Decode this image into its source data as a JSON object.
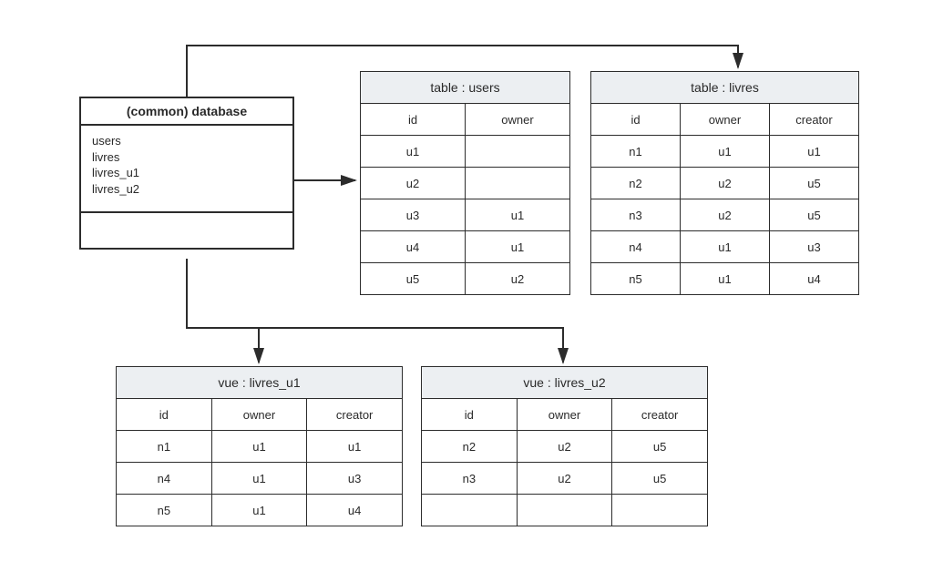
{
  "database": {
    "title": "(common) database",
    "items": [
      "users",
      "livres",
      "livres_u1",
      "livres_u2"
    ]
  },
  "tables": {
    "users": {
      "caption": "table : users",
      "columns": [
        "id",
        "owner"
      ],
      "rows": [
        [
          "u1",
          ""
        ],
        [
          "u2",
          ""
        ],
        [
          "u3",
          "u1"
        ],
        [
          "u4",
          "u1"
        ],
        [
          "u5",
          "u2"
        ]
      ]
    },
    "livres": {
      "caption": "table : livres",
      "columns": [
        "id",
        "owner",
        "creator"
      ],
      "rows": [
        [
          "n1",
          "u1",
          "u1"
        ],
        [
          "n2",
          "u2",
          "u5"
        ],
        [
          "n3",
          "u2",
          "u5"
        ],
        [
          "n4",
          "u1",
          "u3"
        ],
        [
          "n5",
          "u1",
          "u4"
        ]
      ]
    },
    "livres_u1": {
      "caption": "vue : livres_u1",
      "columns": [
        "id",
        "owner",
        "creator"
      ],
      "rows": [
        [
          "n1",
          "u1",
          "u1"
        ],
        [
          "n4",
          "u1",
          "u3"
        ],
        [
          "n5",
          "u1",
          "u4"
        ]
      ]
    },
    "livres_u2": {
      "caption": "vue : livres_u2",
      "columns": [
        "id",
        "owner",
        "creator"
      ],
      "rows": [
        [
          "n2",
          "u2",
          "u5"
        ],
        [
          "n3",
          "u2",
          "u5"
        ],
        [
          "",
          "",
          ""
        ]
      ]
    }
  }
}
